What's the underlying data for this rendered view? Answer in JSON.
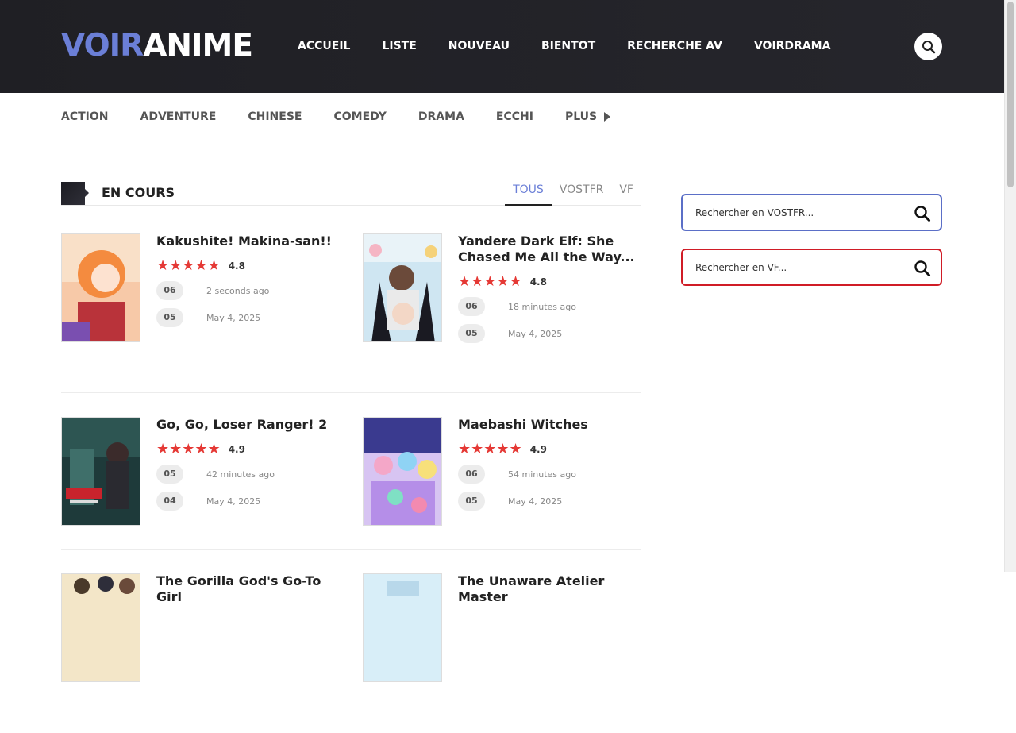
{
  "logo": {
    "part1": "VOIR",
    "part2": "ANIME"
  },
  "nav": [
    "ACCUEIL",
    "LISTE",
    "NOUVEAU",
    "BIENTOT",
    "RECHERCHE AV",
    "VOIRDRAMA"
  ],
  "genres": [
    "ACTION",
    "ADVENTURE",
    "CHINESE",
    "COMEDY",
    "DRAMA",
    "ECCHI"
  ],
  "genres_more": "PLUS",
  "section": {
    "title": "EN COURS",
    "tabs": [
      "TOUS",
      "VOSTFR",
      "VF"
    ],
    "active_tab": "TOUS"
  },
  "items": [
    {
      "title": "Kakushite! Makina-san!!",
      "rating": "4.8",
      "ep1": "06",
      "time1": "2 seconds ago",
      "ep2": "05",
      "time2": "May 4, 2025"
    },
    {
      "title": "Yandere Dark Elf: She Chased Me All the Way...",
      "rating": "4.8",
      "ep1": "06",
      "time1": "18 minutes ago",
      "ep2": "05",
      "time2": "May 4, 2025"
    },
    {
      "title": "Go, Go, Loser Ranger! 2",
      "rating": "4.9",
      "ep1": "05",
      "time1": "42 minutes ago",
      "ep2": "04",
      "time2": "May 4, 2025"
    },
    {
      "title": "Maebashi Witches",
      "rating": "4.9",
      "ep1": "06",
      "time1": "54 minutes ago",
      "ep2": "05",
      "time2": "May 4, 2025"
    },
    {
      "title": "The Gorilla God's Go-To Girl",
      "rating": "",
      "ep1": "",
      "time1": "",
      "ep2": "",
      "time2": ""
    },
    {
      "title": "The Unaware Atelier Master",
      "rating": "",
      "ep1": "",
      "time1": "",
      "ep2": "",
      "time2": ""
    }
  ],
  "stars": "★★★★★",
  "search": {
    "vostfr_placeholder": "Rechercher en VOSTFR...",
    "vf_placeholder": "Rechercher en VF..."
  },
  "colors": {
    "accent": "#6b7fd7",
    "vf_border": "#d01c26",
    "star": "#e53935",
    "header_bg": "#1f1f24"
  }
}
